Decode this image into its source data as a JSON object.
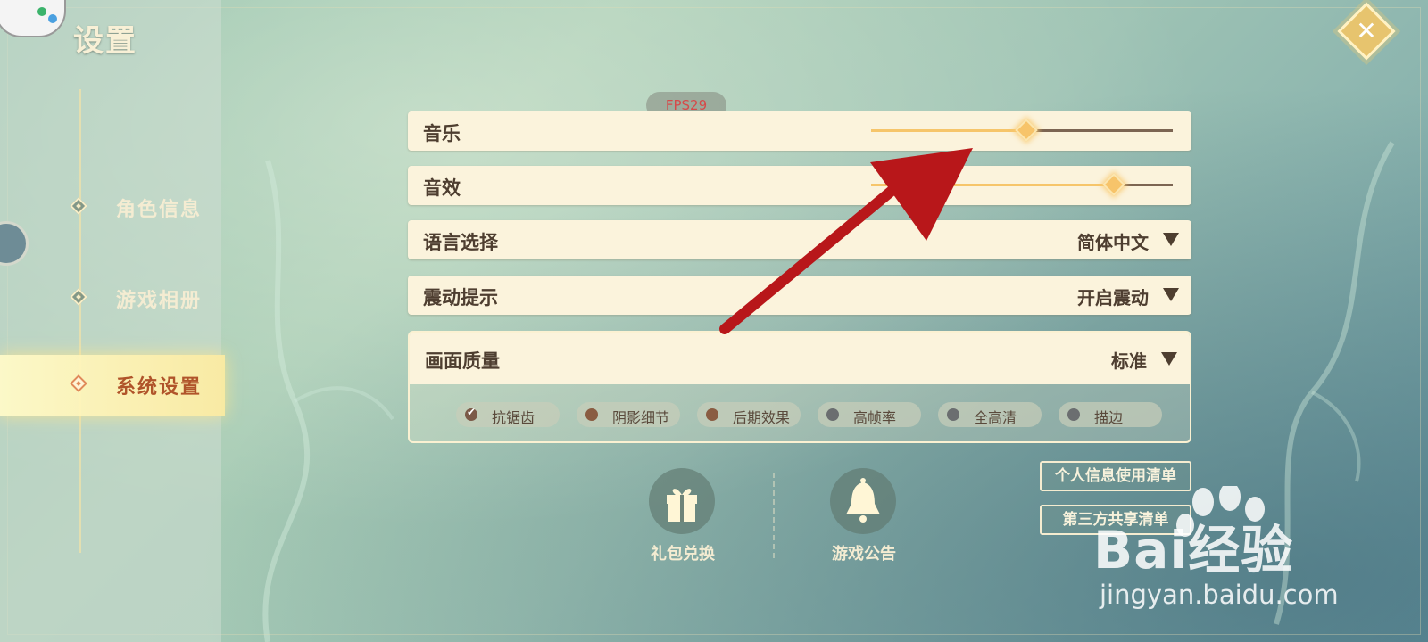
{
  "app": {
    "title": "设置"
  },
  "fps": {
    "label": "FPS29"
  },
  "sidebar": {
    "items": [
      {
        "label": "角色信息",
        "active": false
      },
      {
        "label": "游戏相册",
        "active": false
      },
      {
        "label": "系统设置",
        "active": true
      }
    ]
  },
  "settings": {
    "music": {
      "label": "音乐",
      "level": 0.51
    },
    "sfx": {
      "label": "音效",
      "level": 0.8
    },
    "language": {
      "label": "语言选择",
      "value": "简体中文"
    },
    "vibration": {
      "label": "震动提示",
      "value": "开启震动"
    },
    "quality": {
      "label": "画面质量",
      "value": "标准",
      "options": [
        {
          "label": "抗锯齿",
          "state": "checked",
          "color": "#7b5a48"
        },
        {
          "label": "阴影细节",
          "state": "on",
          "color": "#8a5c42"
        },
        {
          "label": "后期效果",
          "state": "on",
          "color": "#8a5c42"
        },
        {
          "label": "高帧率",
          "state": "off",
          "color": "#6b6e70"
        },
        {
          "label": "全高清",
          "state": "off",
          "color": "#6b6e70"
        },
        {
          "label": "描边",
          "state": "off",
          "color": "#6b6e70"
        }
      ]
    }
  },
  "bottom": {
    "gift": {
      "label": "礼包兑换",
      "icon": "gift-icon"
    },
    "notice": {
      "label": "游戏公告",
      "icon": "bell-icon"
    }
  },
  "links": {
    "privacy": "个人信息使用清单",
    "third_party": "第三方共享清单"
  },
  "watermark": {
    "brand": "Bai经验",
    "url": "jingyan.baidu.com"
  },
  "colors": {
    "accent": "#f6c56a",
    "panel": "#fbf3dc",
    "text": "#4e3e30",
    "arrow": "#b8171a"
  }
}
